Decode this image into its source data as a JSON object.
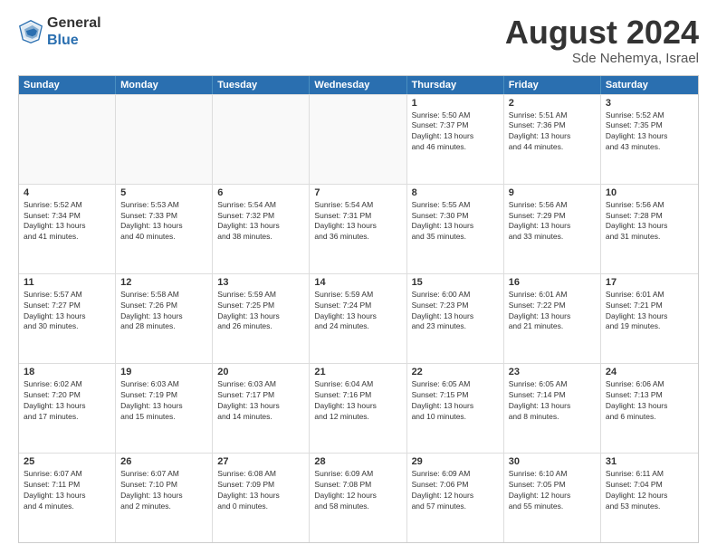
{
  "header": {
    "logo_general": "General",
    "logo_blue": "Blue",
    "month_year": "August 2024",
    "location": "Sde Nehemya, Israel"
  },
  "weekdays": [
    "Sunday",
    "Monday",
    "Tuesday",
    "Wednesday",
    "Thursday",
    "Friday",
    "Saturday"
  ],
  "rows": [
    [
      {
        "day": "",
        "detail": ""
      },
      {
        "day": "",
        "detail": ""
      },
      {
        "day": "",
        "detail": ""
      },
      {
        "day": "",
        "detail": ""
      },
      {
        "day": "1",
        "detail": "Sunrise: 5:50 AM\nSunset: 7:37 PM\nDaylight: 13 hours\nand 46 minutes."
      },
      {
        "day": "2",
        "detail": "Sunrise: 5:51 AM\nSunset: 7:36 PM\nDaylight: 13 hours\nand 44 minutes."
      },
      {
        "day": "3",
        "detail": "Sunrise: 5:52 AM\nSunset: 7:35 PM\nDaylight: 13 hours\nand 43 minutes."
      }
    ],
    [
      {
        "day": "4",
        "detail": "Sunrise: 5:52 AM\nSunset: 7:34 PM\nDaylight: 13 hours\nand 41 minutes."
      },
      {
        "day": "5",
        "detail": "Sunrise: 5:53 AM\nSunset: 7:33 PM\nDaylight: 13 hours\nand 40 minutes."
      },
      {
        "day": "6",
        "detail": "Sunrise: 5:54 AM\nSunset: 7:32 PM\nDaylight: 13 hours\nand 38 minutes."
      },
      {
        "day": "7",
        "detail": "Sunrise: 5:54 AM\nSunset: 7:31 PM\nDaylight: 13 hours\nand 36 minutes."
      },
      {
        "day": "8",
        "detail": "Sunrise: 5:55 AM\nSunset: 7:30 PM\nDaylight: 13 hours\nand 35 minutes."
      },
      {
        "day": "9",
        "detail": "Sunrise: 5:56 AM\nSunset: 7:29 PM\nDaylight: 13 hours\nand 33 minutes."
      },
      {
        "day": "10",
        "detail": "Sunrise: 5:56 AM\nSunset: 7:28 PM\nDaylight: 13 hours\nand 31 minutes."
      }
    ],
    [
      {
        "day": "11",
        "detail": "Sunrise: 5:57 AM\nSunset: 7:27 PM\nDaylight: 13 hours\nand 30 minutes."
      },
      {
        "day": "12",
        "detail": "Sunrise: 5:58 AM\nSunset: 7:26 PM\nDaylight: 13 hours\nand 28 minutes."
      },
      {
        "day": "13",
        "detail": "Sunrise: 5:59 AM\nSunset: 7:25 PM\nDaylight: 13 hours\nand 26 minutes."
      },
      {
        "day": "14",
        "detail": "Sunrise: 5:59 AM\nSunset: 7:24 PM\nDaylight: 13 hours\nand 24 minutes."
      },
      {
        "day": "15",
        "detail": "Sunrise: 6:00 AM\nSunset: 7:23 PM\nDaylight: 13 hours\nand 23 minutes."
      },
      {
        "day": "16",
        "detail": "Sunrise: 6:01 AM\nSunset: 7:22 PM\nDaylight: 13 hours\nand 21 minutes."
      },
      {
        "day": "17",
        "detail": "Sunrise: 6:01 AM\nSunset: 7:21 PM\nDaylight: 13 hours\nand 19 minutes."
      }
    ],
    [
      {
        "day": "18",
        "detail": "Sunrise: 6:02 AM\nSunset: 7:20 PM\nDaylight: 13 hours\nand 17 minutes."
      },
      {
        "day": "19",
        "detail": "Sunrise: 6:03 AM\nSunset: 7:19 PM\nDaylight: 13 hours\nand 15 minutes."
      },
      {
        "day": "20",
        "detail": "Sunrise: 6:03 AM\nSunset: 7:17 PM\nDaylight: 13 hours\nand 14 minutes."
      },
      {
        "day": "21",
        "detail": "Sunrise: 6:04 AM\nSunset: 7:16 PM\nDaylight: 13 hours\nand 12 minutes."
      },
      {
        "day": "22",
        "detail": "Sunrise: 6:05 AM\nSunset: 7:15 PM\nDaylight: 13 hours\nand 10 minutes."
      },
      {
        "day": "23",
        "detail": "Sunrise: 6:05 AM\nSunset: 7:14 PM\nDaylight: 13 hours\nand 8 minutes."
      },
      {
        "day": "24",
        "detail": "Sunrise: 6:06 AM\nSunset: 7:13 PM\nDaylight: 13 hours\nand 6 minutes."
      }
    ],
    [
      {
        "day": "25",
        "detail": "Sunrise: 6:07 AM\nSunset: 7:11 PM\nDaylight: 13 hours\nand 4 minutes."
      },
      {
        "day": "26",
        "detail": "Sunrise: 6:07 AM\nSunset: 7:10 PM\nDaylight: 13 hours\nand 2 minutes."
      },
      {
        "day": "27",
        "detail": "Sunrise: 6:08 AM\nSunset: 7:09 PM\nDaylight: 13 hours\nand 0 minutes."
      },
      {
        "day": "28",
        "detail": "Sunrise: 6:09 AM\nSunset: 7:08 PM\nDaylight: 12 hours\nand 58 minutes."
      },
      {
        "day": "29",
        "detail": "Sunrise: 6:09 AM\nSunset: 7:06 PM\nDaylight: 12 hours\nand 57 minutes."
      },
      {
        "day": "30",
        "detail": "Sunrise: 6:10 AM\nSunset: 7:05 PM\nDaylight: 12 hours\nand 55 minutes."
      },
      {
        "day": "31",
        "detail": "Sunrise: 6:11 AM\nSunset: 7:04 PM\nDaylight: 12 hours\nand 53 minutes."
      }
    ]
  ]
}
